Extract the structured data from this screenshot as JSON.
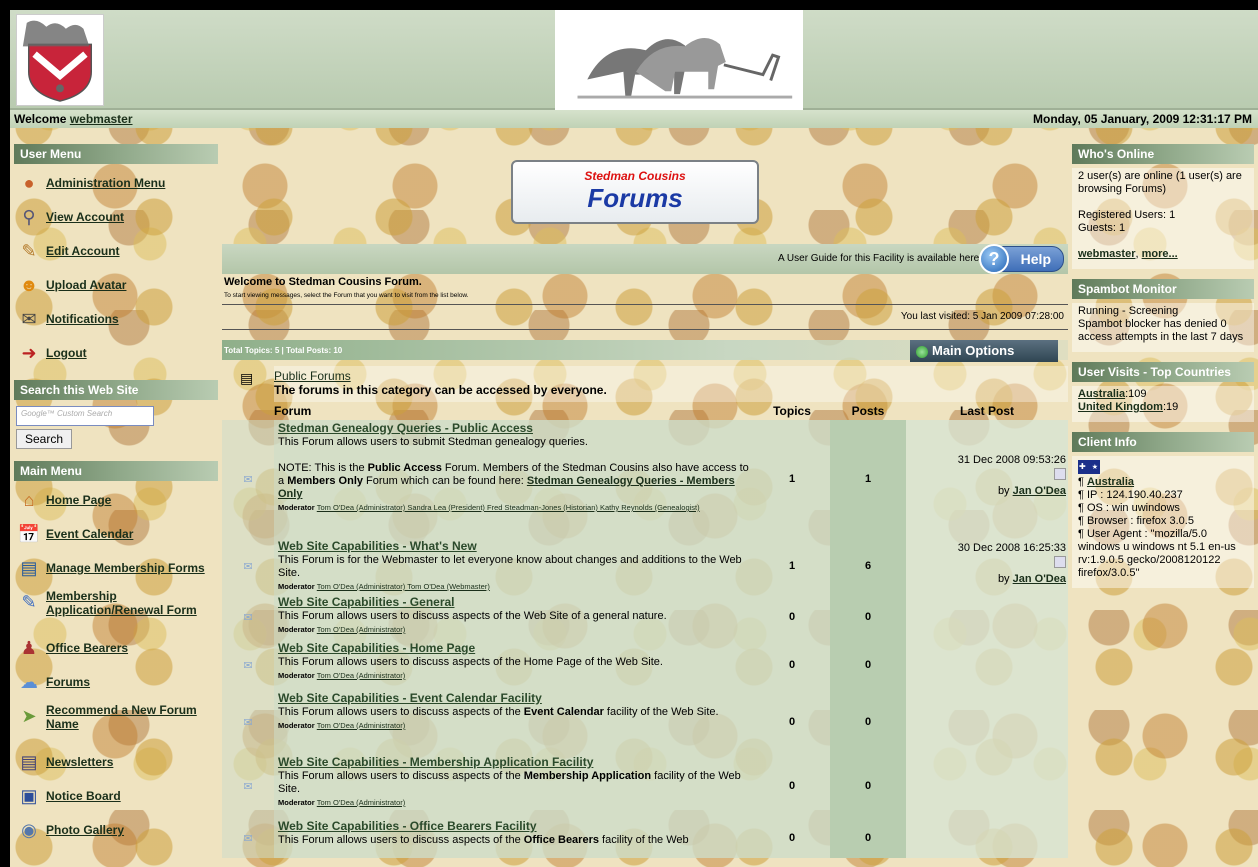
{
  "header": {
    "welcome_prefix": "Welcome",
    "username": "webmaster",
    "datetime": "Monday, 05 January, 2009 12:31:17 PM"
  },
  "user_menu": {
    "title": "User Menu",
    "items": [
      {
        "label": "Administration Menu",
        "icon": "admin-icon"
      },
      {
        "label": "View Account",
        "icon": "magnifier-icon"
      },
      {
        "label": "Edit Account",
        "icon": "pencil-icon"
      },
      {
        "label": "Upload Avatar",
        "icon": "avatar-icon"
      },
      {
        "label": "Notifications",
        "icon": "notification-icon"
      },
      {
        "label": "Logout",
        "icon": "logout-icon"
      }
    ]
  },
  "search": {
    "title": "Search this Web Site",
    "placeholder": "Google™ Custom Search",
    "button": "Search"
  },
  "main_menu": {
    "title": "Main Menu",
    "items": [
      {
        "label": "Home Page"
      },
      {
        "label": "Event Calendar"
      },
      {
        "label": "Manage Membership Forms"
      },
      {
        "label": "Membership Application/Renewal Form"
      },
      {
        "label": "Office Bearers"
      },
      {
        "label": "Forums"
      },
      {
        "label": "Recommend a New Forum Name"
      },
      {
        "label": "Newsletters"
      },
      {
        "label": "Notice Board"
      },
      {
        "label": "Photo Gallery"
      }
    ]
  },
  "badge": {
    "subtitle": "Stedman Cousins",
    "title": "Forums"
  },
  "guide": {
    "text": "A User Guide for this Facility is available here:",
    "help_label": "Help"
  },
  "intro": {
    "heading": "Welcome to Stedman Cousins Forum.",
    "sub": "To start viewing messages, select the Forum that you want to visit from the list below."
  },
  "last_visit": "You last visited: 5 Jan 2009 07:28:00",
  "totals": "Total Topics: 5 | Total Posts: 10",
  "main_options": "Main Options",
  "category": {
    "name": "Public Forums",
    "desc": "The forums in this category can be accessed by everyone."
  },
  "columns": {
    "forum": "Forum",
    "topics": "Topics",
    "posts": "Posts",
    "last_post": "Last Post"
  },
  "forums": [
    {
      "title": "Stedman Genealogy Queries - Public Access",
      "desc": "This Forum allows users to submit Stedman genealogy queries.",
      "note_a": "NOTE: This is the ",
      "note_b": "Public Access",
      "note_c": " Forum. Members of the Stedman Cousins also have access to a ",
      "note_d": "Members Only",
      "note_e": " Forum which can be found here: ",
      "note_link": "Stedman Genealogy Queries - Members Only",
      "mod_label": "Moderator",
      "mods": "Tom O'Dea (Administrator) Sandra Lea (President) Fred Steadman-Jones (Historian) Kathy Reynolds (Genealogist)",
      "topics": "1",
      "posts": "1",
      "last_date": "31 Dec 2008 09:53:26",
      "last_by": "by",
      "last_user": "Jan O'Dea"
    },
    {
      "title": "Web Site Capabilities - What's New",
      "desc": "This Forum is for the Webmaster to let everyone know about changes and additions to the Web Site.",
      "mod_label": "Moderator",
      "mods": "Tom O'Dea (Administrator) Tom O'Dea (Webmaster)",
      "topics": "1",
      "posts": "6",
      "last_date": "30 Dec 2008 16:25:33",
      "last_by": "by",
      "last_user": "Jan O'Dea"
    },
    {
      "title": "Web Site Capabilities - General",
      "desc": "This Forum allows users to discuss aspects of the Web Site of a general nature.",
      "mod_label": "Moderator",
      "mods": "Tom O'Dea (Administrator)",
      "topics": "0",
      "posts": "0"
    },
    {
      "title": "Web Site Capabilities - Home Page",
      "desc": "This Forum allows users to discuss aspects of the Home Page of the Web Site.",
      "mod_label": "Moderator",
      "mods": "Tom O'Dea (Administrator)",
      "topics": "0",
      "posts": "0"
    },
    {
      "title": "Web Site Capabilities - Event Calendar Facility",
      "desc_a": "This Forum allows users to discuss aspects of the ",
      "desc_b": "Event Calendar",
      "desc_c": " facility of the Web Site.",
      "mod_label": "Moderator",
      "mods": "Tom O'Dea (Administrator)",
      "topics": "0",
      "posts": "0"
    },
    {
      "title": "Web Site Capabilities - Membership Application Facility",
      "desc_a": "This Forum allows users to discuss aspects of the ",
      "desc_b": "Membership Application",
      "desc_c": " facility of the Web Site.",
      "mod_label": "Moderator",
      "mods": "Tom O'Dea (Administrator)",
      "topics": "0",
      "posts": "0"
    },
    {
      "title": "Web Site Capabilities - Office Bearers Facility",
      "desc_a": "This Forum allows users to discuss aspects of the ",
      "desc_b": "Office Bearers",
      "desc_c": " facility of the Web",
      "topics": "0",
      "posts": "0"
    }
  ],
  "whos_online": {
    "title": "Who's Online",
    "line1": "2 user(s) are online (1 user(s) are browsing Forums)",
    "registered": "Registered Users: 1",
    "guests": "Guests: 1",
    "user_link": "webmaster",
    "more_link": "more..."
  },
  "spambot": {
    "title": "Spambot Monitor",
    "status": "Running - Screening",
    "text": "Spambot blocker has denied 0 access attempts in the last 7 days"
  },
  "visits": {
    "title": "User Visits - Top Countries",
    "rows": [
      {
        "country": "Australia",
        "count": ":109"
      },
      {
        "country": "United Kingdom",
        "count": ":19"
      }
    ]
  },
  "client": {
    "title": "Client Info",
    "country": "Australia",
    "ip": "¶ IP : 124.190.40.237",
    "os": "¶ OS : win uwindows",
    "browser": "¶ Browser : firefox 3.0.5",
    "agent": "¶ User Agent : \"mozilla/5.0 windows u windows nt 5.1 en-us rv:1.9.0.5 gecko/2008120122 firefox/3.0.5\""
  },
  "colors": {
    "accent": "#1b3aa5",
    "brand_red": "#d11111",
    "menu_green": "#5f7a5a"
  }
}
